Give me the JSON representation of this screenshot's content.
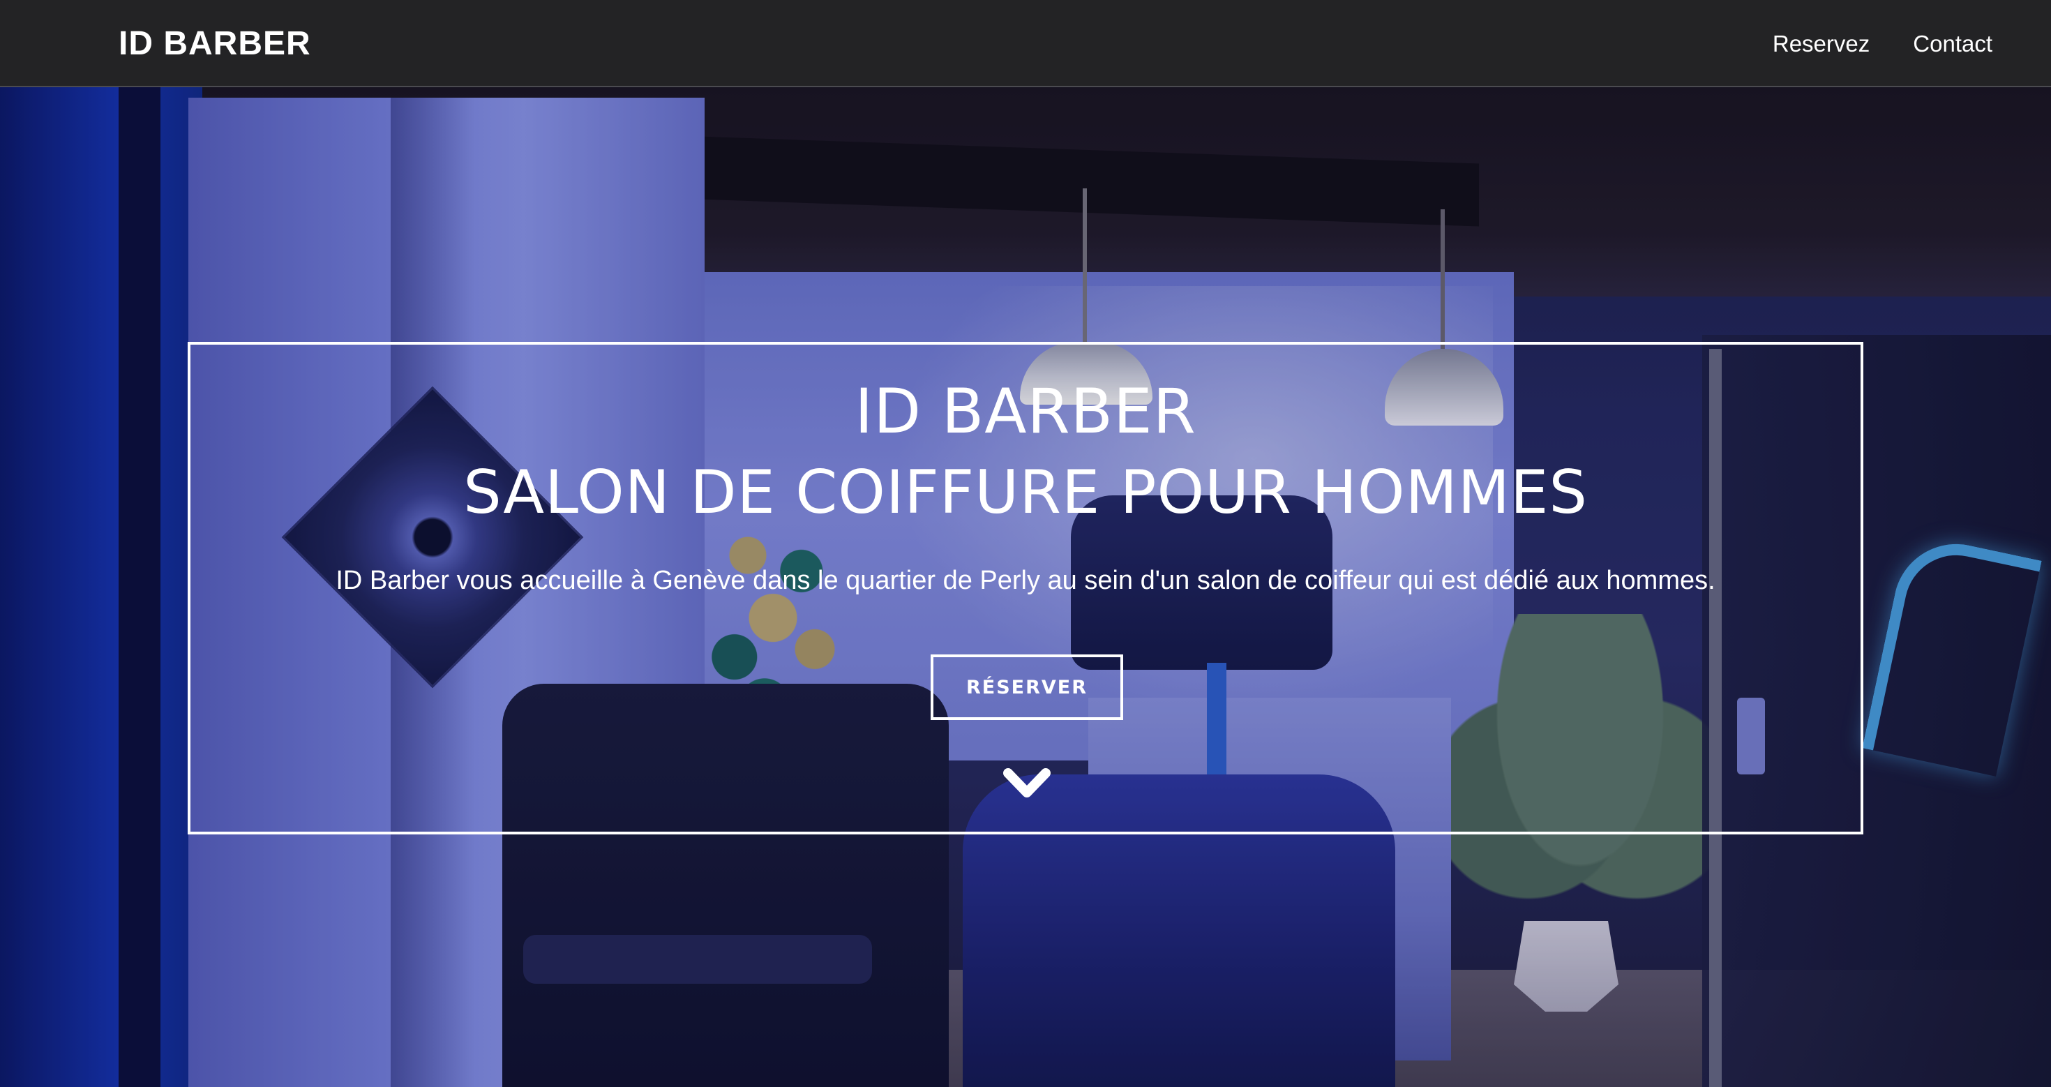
{
  "navbar": {
    "brand": "ID BARBER",
    "links": [
      {
        "label": "Reservez"
      },
      {
        "label": "Contact"
      }
    ]
  },
  "hero": {
    "title": "ID BARBER",
    "subtitle": "SALON DE COIFFURE POUR HOMMES",
    "description": "ID Barber vous accueille à Genève dans le quartier de Perly au sein d'un salon de coiffeur qui est dédié aux hommes.",
    "button_label": "RÉSERVER",
    "scroll_icon": "chevron-down-icon"
  },
  "colors": {
    "navbar_bg": "#232325",
    "text": "#ffffff",
    "hero_tint": "#2b2f6c"
  }
}
